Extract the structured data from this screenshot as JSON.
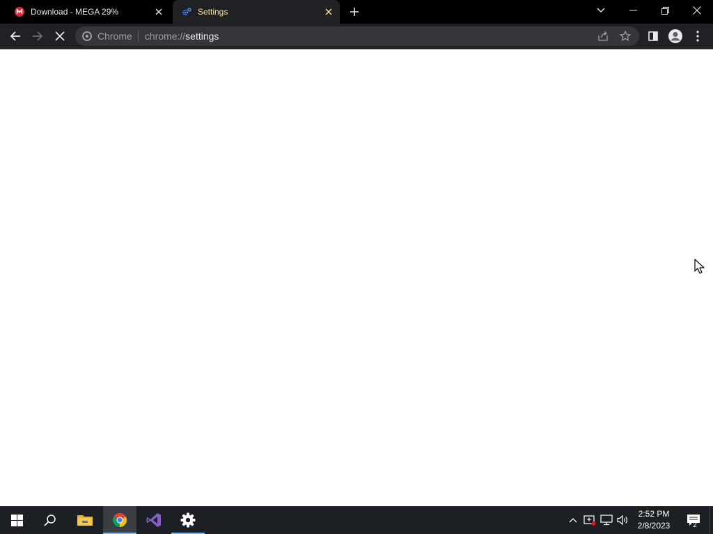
{
  "browser": {
    "tabs": [
      {
        "title": "Download - MEGA 29%",
        "favicon": "mega-icon",
        "active": false
      },
      {
        "title": "Settings",
        "favicon": "settings-gear-icon",
        "active": true
      }
    ],
    "omnibox": {
      "chip_label": "Chrome",
      "url_scheme": "chrome://",
      "url_path": "settings"
    },
    "colors": {
      "frame": "#000000",
      "toolbar": "#202124",
      "active_tab_title": "#fde293",
      "mega_red": "#d9272e"
    }
  },
  "taskbar": {
    "apps": [
      "start-icon",
      "search-icon",
      "file-explorer-icon",
      "chrome-icon",
      "visual-studio-icon",
      "settings-icon"
    ],
    "clock": {
      "time": "2:52 PM",
      "date": "2/8/2023"
    },
    "notification_count": "2"
  }
}
